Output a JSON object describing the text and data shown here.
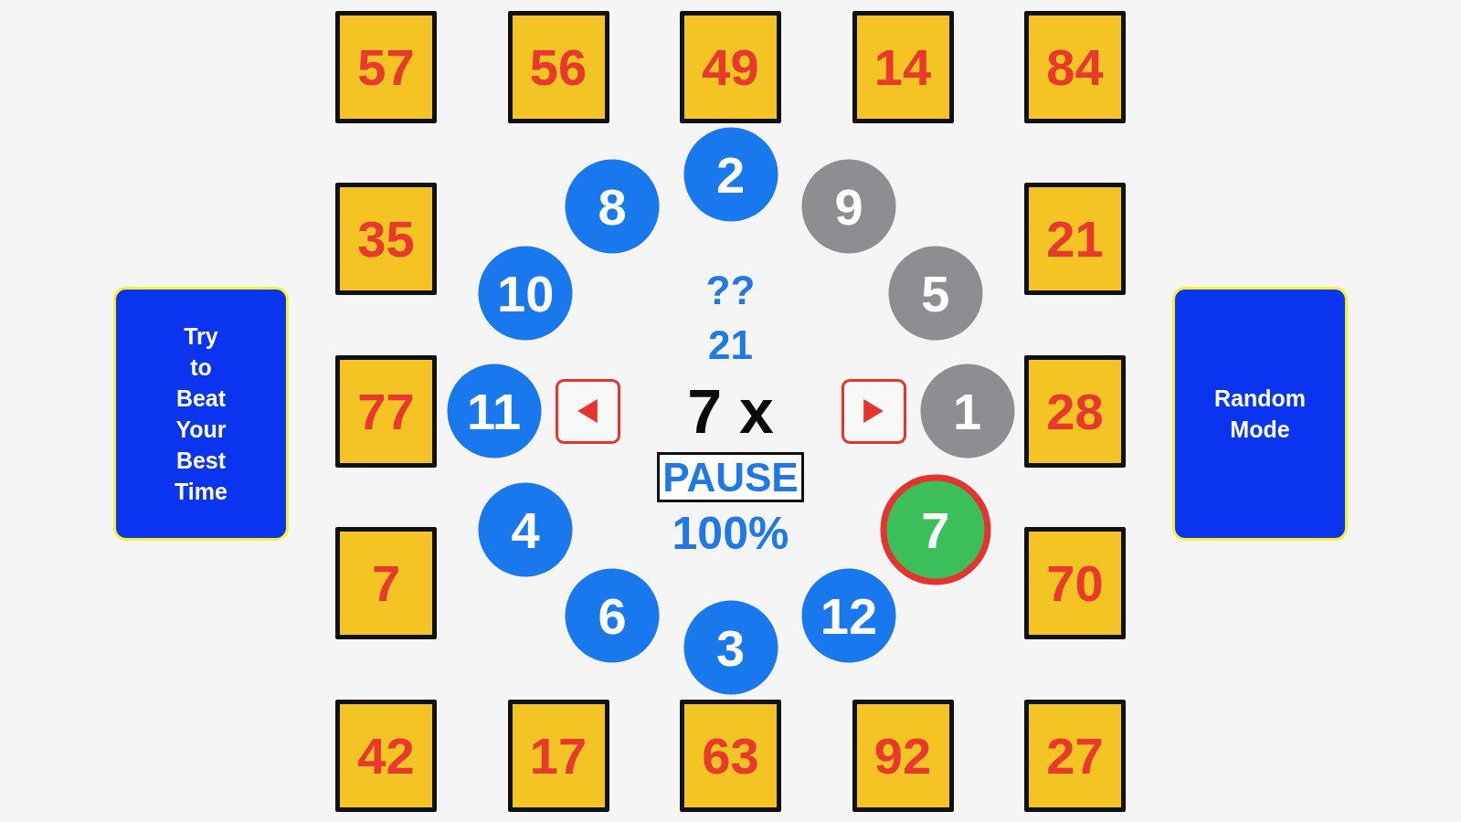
{
  "challenge_button": {
    "label": "Try to Beat Your Best Time"
  },
  "tiles": [
    "57",
    "56",
    "49",
    "14",
    "84",
    "35",
    "21",
    "77",
    "28",
    "7",
    "70",
    "42",
    "17",
    "63",
    "92",
    "27"
  ],
  "clock_numbers": [
    {
      "label": "2",
      "done": false,
      "selected": false
    },
    {
      "label": "9",
      "done": true,
      "selected": false
    },
    {
      "label": "5",
      "done": true,
      "selected": false
    },
    {
      "label": "1",
      "done": true,
      "selected": false
    },
    {
      "label": "7",
      "done": false,
      "selected": true
    },
    {
      "label": "12",
      "done": false,
      "selected": false
    },
    {
      "label": "3",
      "done": false,
      "selected": false
    },
    {
      "label": "6",
      "done": false,
      "selected": false
    },
    {
      "label": "4",
      "done": false,
      "selected": false
    },
    {
      "label": "11",
      "done": false,
      "selected": false
    },
    {
      "label": "10",
      "done": false,
      "selected": false
    },
    {
      "label": "8",
      "done": false,
      "selected": false
    }
  ],
  "center": {
    "hidden_answer": "??",
    "answer": "21",
    "equation": "7 x",
    "pause_label": "PAUSE",
    "score": "100%"
  },
  "random_button": {
    "label": "Random Mode"
  }
}
